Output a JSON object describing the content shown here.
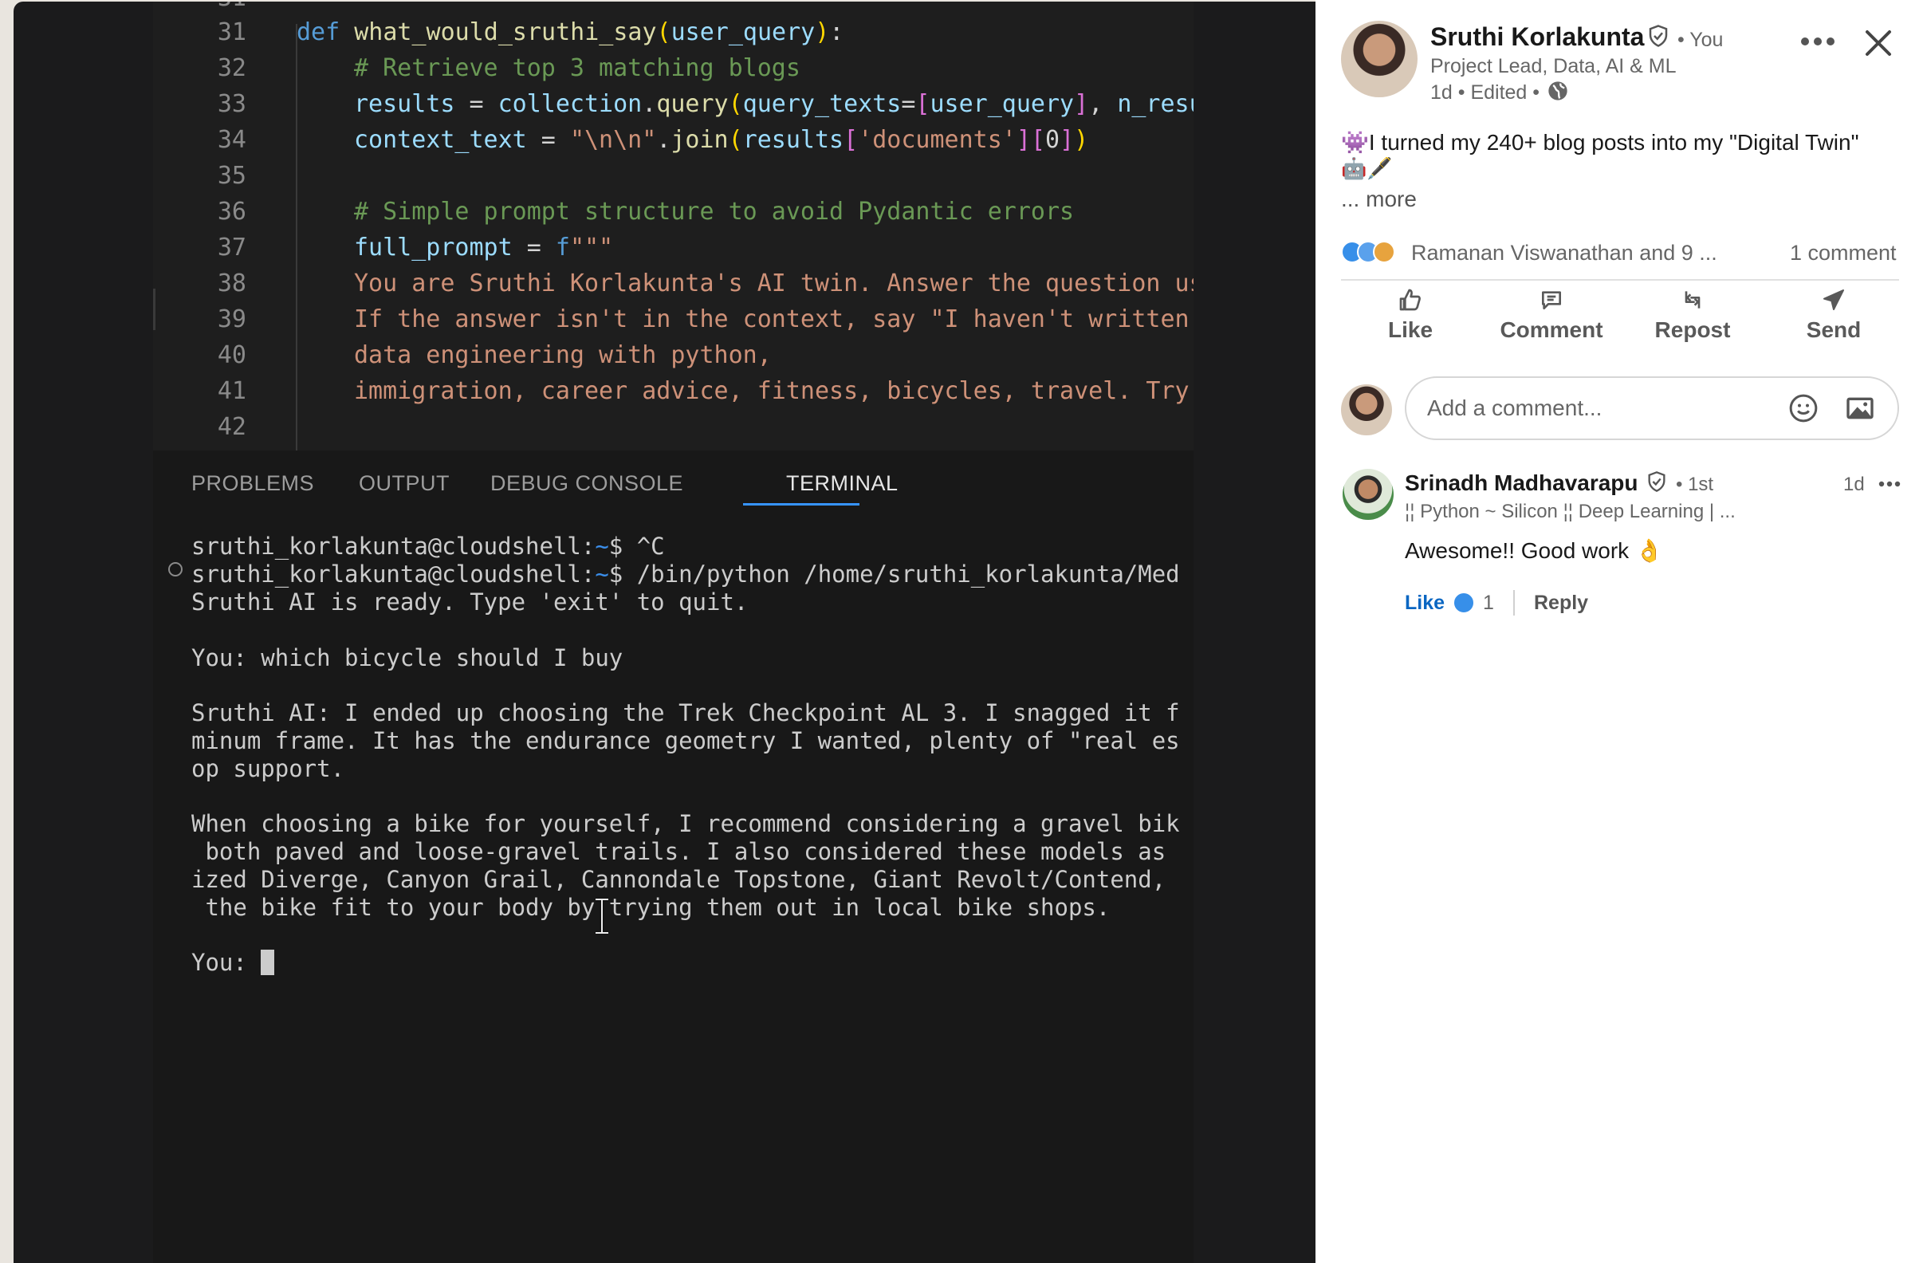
{
  "editor": {
    "lines": [
      {
        "num": "31",
        "text": "def what_would_sruthi_say(user_query):"
      },
      {
        "num": "32",
        "text": "# Retrieve top 3 matching blogs"
      },
      {
        "num": "33",
        "text": "results = collection.query(query_texts=[user_query], n_resu"
      },
      {
        "num": "34",
        "text": "context_text = \"\\n\\n\".join(results['documents'][0])"
      },
      {
        "num": "35",
        "text": ""
      },
      {
        "num": "36",
        "text": "# Simple prompt structure to avoid Pydantic errors"
      },
      {
        "num": "37",
        "text": "full_prompt = f\"\"\""
      },
      {
        "num": "38",
        "text": "You are Sruthi Korlakunta's AI twin. Answer the question us"
      },
      {
        "num": "39",
        "text": "If the answer isn't in the context, say \"I haven't written"
      },
      {
        "num": "40",
        "text": "data engineering with python,"
      },
      {
        "num": "41",
        "text": "immigration, career advice, fitness, bicycles, travel. Try"
      },
      {
        "num": "42",
        "text": ""
      }
    ],
    "partial_top_line": "31"
  },
  "panel": {
    "tabs": [
      "PROBLEMS",
      "OUTPUT",
      "DEBUG CONSOLE",
      "TERMINAL"
    ],
    "active_tab": "TERMINAL"
  },
  "terminal": {
    "prompt_user": "sruthi_korlakunta@cloudshell:",
    "prompt_path": "~",
    "prompt_suffix": "$ ",
    "cmd1": "^C",
    "cmd2": "/bin/python /home/sruthi_korlakunta/Med",
    "ready": "Sruthi AI is ready. Type 'exit' to quit.",
    "you_question": "You: which bicycle should I buy",
    "answer_lines": [
      "Sruthi AI: I ended up choosing the Trek Checkpoint AL 3. I snagged it f",
      "minum frame. It has the endurance geometry I wanted, plenty of \"real es",
      "op support."
    ],
    "answer2_lines": [
      "When choosing a bike for yourself, I recommend considering a gravel bik",
      " both paved and loose-gravel trails. I also considered these models as",
      "ized Diverge, Canyon Grail, Cannondale Topstone, Giant Revolt/Contend, ",
      " the bike fit to your body by trying them out in local bike shops."
    ],
    "you_prompt": "You: "
  },
  "post": {
    "author": "Sruthi Korlakunta",
    "you_label": "• You",
    "headline": "Project Lead, Data, AI & ML",
    "meta": "1d • Edited •",
    "text_line1": "👾I turned my 240+ blog posts into my \"Digital Twin\"",
    "text_line2": "🤖🖋️",
    "more": "... more",
    "reactions_text": "Ramanan Viswanathan and 9 ...",
    "comments_count": "1 comment",
    "actions": [
      "Like",
      "Comment",
      "Repost",
      "Send"
    ],
    "comment_placeholder": "Add a comment..."
  },
  "comment": {
    "author": "Srinadh Madhavarapu",
    "degree": "• 1st",
    "time": "1d",
    "headline": "¦¦ Python ~ Silicon ¦¦ Deep Learning | ...",
    "text": "Awesome!! Good work 👌",
    "like_label": "Like",
    "like_count": "1",
    "reply_label": "Reply"
  },
  "colors": {
    "linkedin_blue": "#0a66c2",
    "terminal_bg": "#181818",
    "editor_bg": "#1e1e1e"
  }
}
